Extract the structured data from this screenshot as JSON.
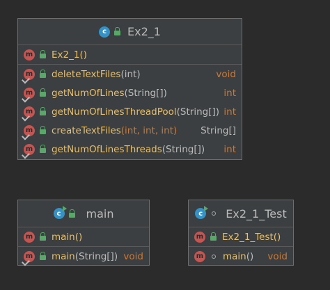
{
  "classes": [
    {
      "name": "Ex2_1",
      "constructors": [
        {
          "name": "Ex2_1()",
          "params": "",
          "ret": ""
        }
      ],
      "methods": [
        {
          "name": "deleteTextFiles",
          "params": "(int)",
          "ret": "void"
        },
        {
          "name": "getNumOfLines",
          "params": "(String[])",
          "ret": "int"
        },
        {
          "name": "getNumOfLinesThreadPool",
          "params": "(String[])",
          "ret": "int"
        },
        {
          "name": "createTextFiles",
          "params": "(int, int, int)",
          "ret": "String[]"
        },
        {
          "name": "getNumOfLinesThreads",
          "params": "(String[])",
          "ret": "int"
        }
      ]
    },
    {
      "name": "main",
      "constructors": [
        {
          "name": "main()",
          "params": "",
          "ret": ""
        }
      ],
      "methods": [
        {
          "name": "main",
          "params": "(String[])",
          "ret": "void"
        }
      ]
    },
    {
      "name": "Ex2_1_Test",
      "constructors": [
        {
          "name": "Ex2_1_Test()",
          "params": "",
          "ret": ""
        }
      ],
      "methods": [
        {
          "name": "main",
          "params": "()",
          "ret": "void"
        }
      ]
    }
  ],
  "icons": {
    "class": "class-icon",
    "method": "method-icon",
    "public": "public-lock-icon",
    "package_private": "package-private-icon"
  },
  "colors": {
    "background": "#2b2b2b",
    "box": "#3c3f41",
    "method_icon": "#c75450",
    "class_icon": "#3592c4",
    "public_lock": "#59a869",
    "method_name": "#e8bf6a",
    "return_type": "#cc7832"
  }
}
